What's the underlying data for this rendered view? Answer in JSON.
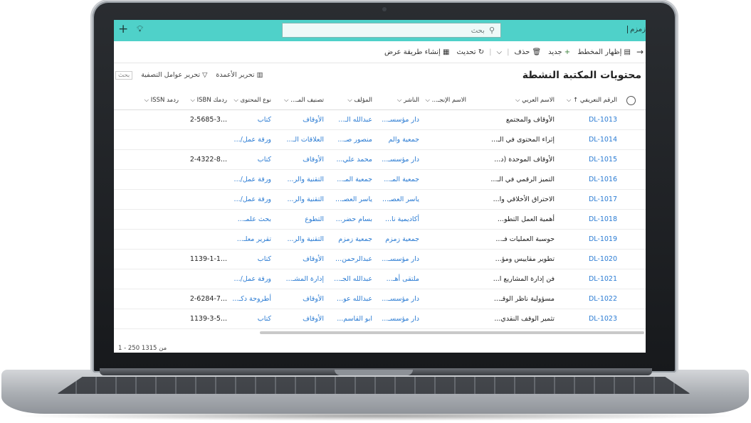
{
  "topbar": {
    "search_placeholder": "بحث",
    "brand": "زمزم"
  },
  "commands": {
    "show_chart": "إظهار المخطط",
    "new": "جديد",
    "delete": "حذف",
    "refresh": "تحديث",
    "create_view": "إنشاء طريقة عرض"
  },
  "view": {
    "title": "محتويات المكتبة النشطة",
    "edit_columns": "تحرير الأعمدة",
    "edit_filters": "تحرير عوامل التصفية",
    "search_mini": "بحث"
  },
  "columns": {
    "id": "الرقم التعريفي ↑",
    "arabic_name": "الاسم العربي",
    "english_name": "الاسم الإنجـ...",
    "publisher": "الناشر",
    "author": "المؤلف",
    "classification": "تصنيف المـ...",
    "content_type": "نوع المحتوى",
    "isbn": "ردمك ISBN",
    "issn": "ردمد ISSN"
  },
  "rows": [
    {
      "id": "DL-1013",
      "arabic_name": "الأوقاف والمجتمع",
      "english_name": "",
      "publisher": "دار مؤسسـ...",
      "author": "عبدالله الـ...",
      "classification": "الأوقاف",
      "content_type": "كتاب",
      "isbn": "...2-5685-3",
      "issn": ""
    },
    {
      "id": "DL-1014",
      "arabic_name": "إثراء المحتوى في الـ...",
      "english_name": "",
      "publisher": "جمعية والم",
      "author": "منصور صـ...",
      "classification": "العلاقات الـ...",
      "content_type": "ورقة عمل/...",
      "isbn": "",
      "issn": ""
    },
    {
      "id": "DL-1015",
      "arabic_name": "الأوقاف الموحدة (د...",
      "english_name": "",
      "publisher": "دار مؤسسـ...",
      "author": "محمد علي...",
      "classification": "الأوقاف",
      "content_type": "كتاب",
      "isbn": "...2-4322-8",
      "issn": ""
    },
    {
      "id": "DL-1016",
      "arabic_name": "التميز الرقمي في الـ...",
      "english_name": "",
      "publisher": "جمعية المـ...",
      "author": "جمعية المـ...",
      "classification": "التقنية والر...",
      "content_type": "ورقة عمل/...",
      "isbn": "",
      "issn": ""
    },
    {
      "id": "DL-1017",
      "arabic_name": "الاحتراق الأخلاقي وا...",
      "english_name": "",
      "publisher": "ياسر العصـ...",
      "author": "ياسر العصـ...",
      "classification": "التقنية والر...",
      "content_type": "ورقة عمل/...",
      "isbn": "",
      "issn": ""
    },
    {
      "id": "DL-1018",
      "arabic_name": "أهمية العمل التطو...",
      "english_name": "",
      "publisher": "أكاديمية نا...",
      "author": "بسام حضر...",
      "classification": "التطوع",
      "content_type": "بحث علمـ...",
      "isbn": "",
      "issn": ""
    },
    {
      "id": "DL-1019",
      "arabic_name": "حوسبة العمليات فـ...",
      "english_name": "",
      "publisher": "جمعية زمزم",
      "author": "جمعية زمزم",
      "classification": "التقنية والر...",
      "content_type": "تقرير معلـ...",
      "isbn": "",
      "issn": ""
    },
    {
      "id": "DL-1020",
      "arabic_name": "تطوير مقاييس ومؤ...",
      "english_name": "",
      "publisher": "دار مؤسسـ...",
      "author": "عبدالرحمن...",
      "classification": "الأوقاف",
      "content_type": "كتاب",
      "isbn": "...1139-1-1",
      "issn": ""
    },
    {
      "id": "DL-1021",
      "arabic_name": "فن إدارة المشاريع ا...",
      "english_name": "",
      "publisher": "ملتقى أهـ...",
      "author": "عبدالله الجـ...",
      "classification": "إدارة المشـ...",
      "content_type": "ورقة عمل/...",
      "isbn": "",
      "issn": ""
    },
    {
      "id": "DL-1022",
      "arabic_name": "مسؤولية ناظر الوقـ...",
      "english_name": "",
      "publisher": "دار مؤسسـ...",
      "author": "عبدالله عو...",
      "classification": "الأوقاف",
      "content_type": "أطروحة دكـ...",
      "isbn": "...2-6284-7",
      "issn": ""
    },
    {
      "id": "DL-1023",
      "arabic_name": "تثمير الوقف النقدي...",
      "english_name": "",
      "publisher": "دار مؤسسـ...",
      "author": "ابو القاسم...",
      "classification": "الأوقاف",
      "content_type": "كتاب",
      "isbn": "...1139-3-5",
      "issn": ""
    }
  ],
  "footer": "1 - 250 من 1315"
}
